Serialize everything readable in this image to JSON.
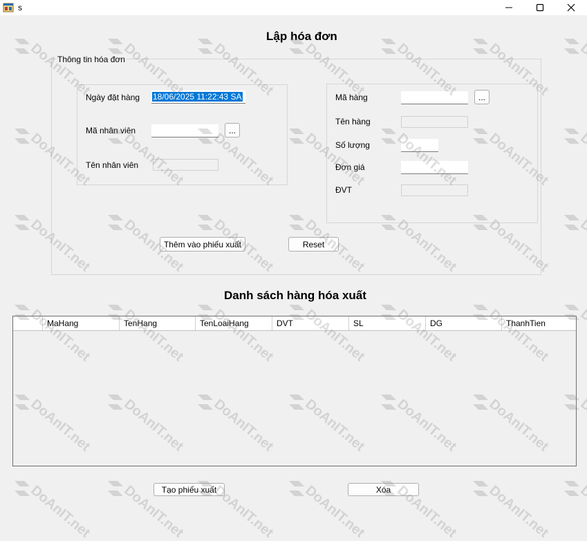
{
  "window": {
    "title": "s",
    "icons": {
      "app": "form-icon",
      "minimize": "minimize-icon",
      "maximize": "maximize-icon",
      "close": "close-icon"
    }
  },
  "header": {
    "title": "Lập hóa đơn"
  },
  "info_group": {
    "legend": "Thông tin hóa đơn",
    "order_date_label": "Ngày đặt hàng",
    "order_date_value": "18/06/2025 11:22:43 SA",
    "employee_id_label": "Mã nhân viên",
    "employee_id_value": "",
    "employee_name_label": "Tên nhân viên",
    "employee_name_value": "",
    "browse_label": "...",
    "product_id_label": "Mã hàng",
    "product_id_value": "",
    "product_name_label": "Tên hàng",
    "product_name_value": "",
    "quantity_label": "Số lượng",
    "quantity_value": "",
    "price_label": "Đơn giá",
    "price_value": "",
    "unit_label": "ĐVT",
    "unit_value": ""
  },
  "actions": {
    "add_label": "Thêm vào phiếu xuất",
    "reset_label": "Reset"
  },
  "list": {
    "title": "Danh sách hàng hóa xuất",
    "columns": [
      "MaHang",
      "TenHang",
      "TenLoaiHang",
      "DVT",
      "SL",
      "DG",
      "ThanhTien"
    ]
  },
  "footer": {
    "create_label": "Tạo phiếu xuất",
    "delete_label": "Xóa"
  },
  "watermark": {
    "text": "DoAnIT.net"
  },
  "colors": {
    "selection": "#0078d7",
    "background": "#f0f0f0"
  }
}
